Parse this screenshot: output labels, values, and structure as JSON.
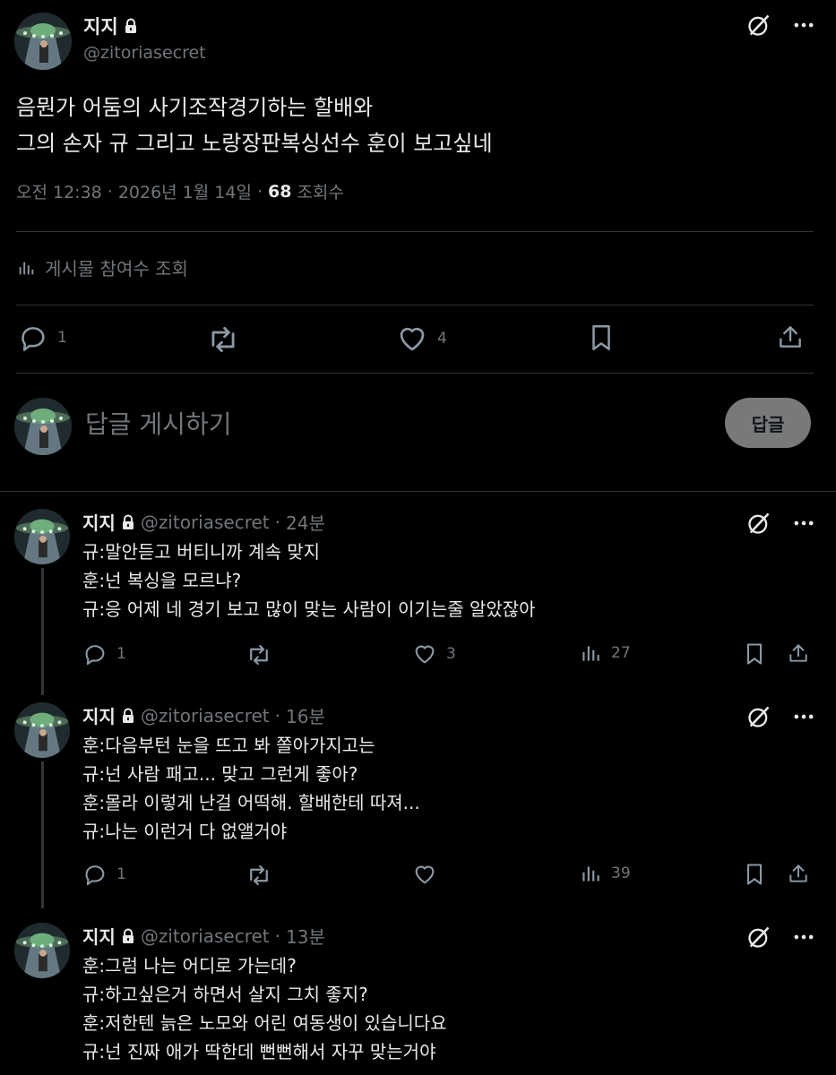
{
  "post": {
    "author_name": "지지",
    "handle": "@zitoriasecret",
    "text_lines": [
      "음뭔가 어둠의 사기조작경기하는 할배와",
      "그의 손자 규 그리고 노랑장판복싱선수 훈이 보고싶네"
    ],
    "time": "오전 12:38",
    "separator": "·",
    "date": "2026년 1월 14일",
    "views_number": "68",
    "views_label": "조회수",
    "engagement_label": "게시물 참여수 조회",
    "actions": {
      "reply_count": "1",
      "repost_count": "",
      "like_count": "4"
    }
  },
  "composer": {
    "placeholder": "답글 게시하기",
    "button_label": "답글"
  },
  "replies": [
    {
      "author_name": "지지",
      "handle": "@zitoriasecret",
      "separator": "·",
      "time_ago": "24분",
      "lines": [
        "규:말안듣고 버티니까 계속 맞지",
        "훈:넌 복싱을 모르냐?",
        "규:응 어제 네 경기 보고 많이 맞는 사람이 이기는줄 알았잖아"
      ],
      "reply_count": "1",
      "like_count": "3",
      "views_count": "27"
    },
    {
      "author_name": "지지",
      "handle": "@zitoriasecret",
      "separator": "·",
      "time_ago": "16분",
      "lines": [
        "훈:다음부턴 눈을 뜨고 봐 쫄아가지고는",
        "규:넌 사람 패고... 맞고 그런게 좋아?",
        "훈:몰라 이렇게 난걸 어떡해. 할배한테 따져...",
        "규:나는 이런거 다 없앨거야"
      ],
      "reply_count": "1",
      "like_count": "",
      "views_count": "39"
    },
    {
      "author_name": "지지",
      "handle": "@zitoriasecret",
      "separator": "·",
      "time_ago": "13분",
      "lines": [
        "훈:그럼 나는 어디로 가는데?",
        "규:하고싶은거 하면서 살지 그치 좋지?",
        "훈:저한텐 늙은 노모와 어린 여동생이 있습니다요",
        "규:넌 진짜 애가 딱한데 뻔뻔해서 자꾸 맞는거야"
      ]
    }
  ],
  "icons": {
    "lock": "lock-icon",
    "grok": "grok-icon",
    "more": "more-icon",
    "reply": "reply-icon",
    "repost": "repost-icon",
    "like": "like-icon",
    "views": "views-icon",
    "bookmark": "bookmark-icon",
    "share": "share-icon"
  },
  "colors": {
    "background": "#000000",
    "text": "#e7e9ea",
    "muted": "#71767b",
    "divider": "#2f3336",
    "button_bg": "#787a7a"
  }
}
